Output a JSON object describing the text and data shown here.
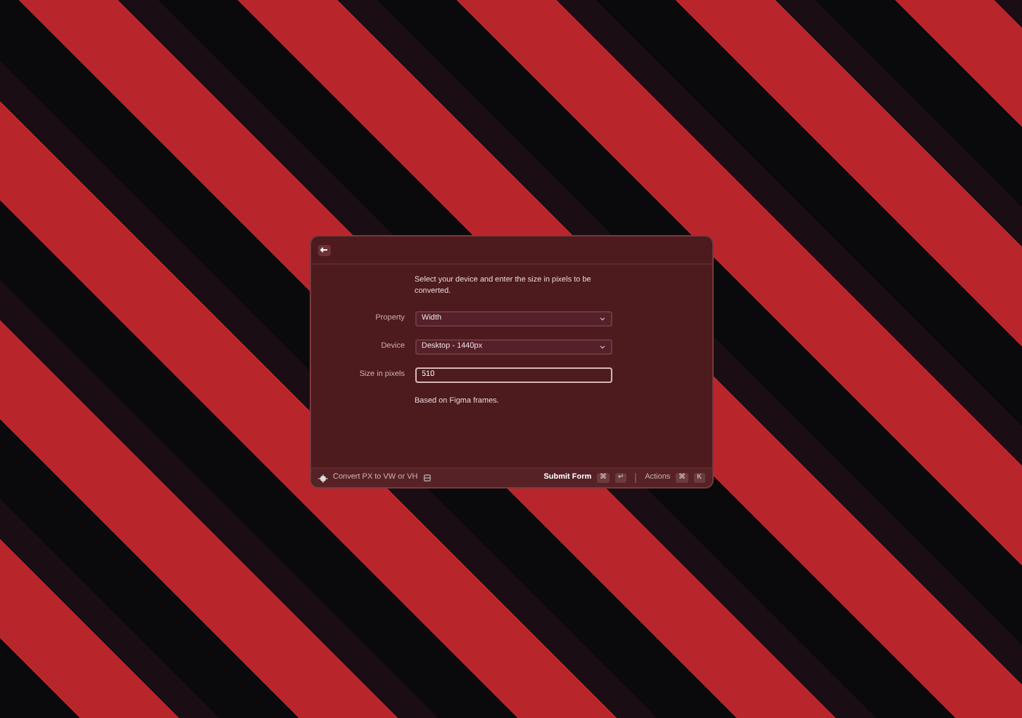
{
  "window": {
    "description": "Select your device and enter the size in pixels to be converted."
  },
  "fields": [
    {
      "kind": "select",
      "label": "Property",
      "value": "Width"
    },
    {
      "kind": "select",
      "label": "Device",
      "value": "Desktop - 1440px"
    },
    {
      "kind": "input",
      "label": "Size in pixels",
      "value": "510"
    }
  ],
  "note": "Based on Figma frames.",
  "footer": {
    "title": "Convert PX to VW or VH",
    "primary_action": "Submit Form",
    "primary_keys": [
      "⌘",
      "↵"
    ],
    "actions_label": "Actions",
    "actions_keys": [
      "⌘",
      "K"
    ]
  }
}
